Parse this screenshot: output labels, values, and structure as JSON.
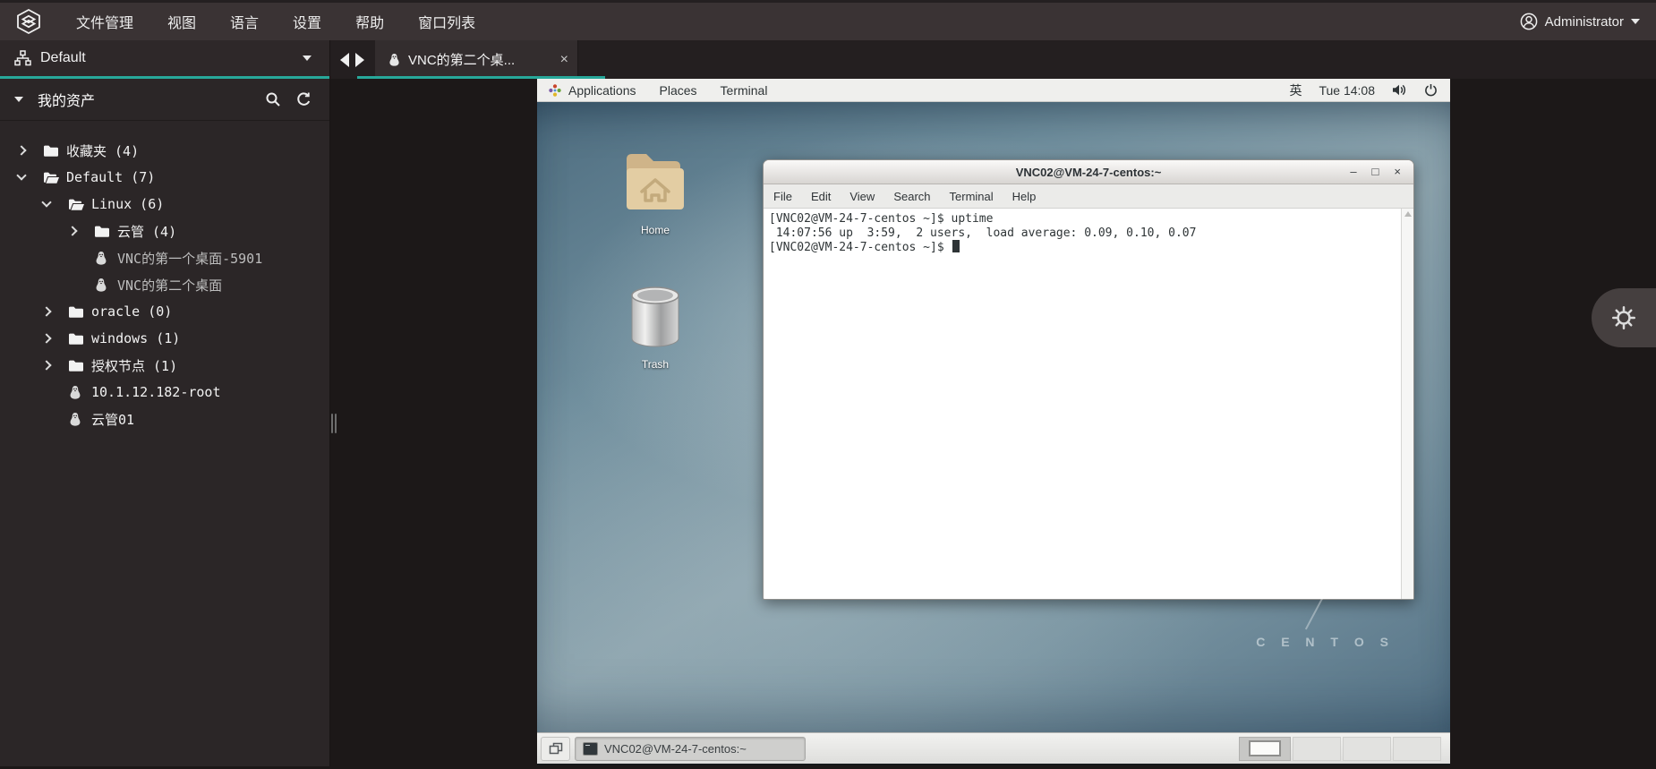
{
  "topbar": {
    "menu_items": [
      "文件管理",
      "视图",
      "语言",
      "设置",
      "帮助",
      "窗口列表"
    ],
    "user_name": "Administrator"
  },
  "sidebar": {
    "profile_label": "Default",
    "assets_title": "我的资产",
    "tree": [
      {
        "label": "收藏夹 (4)"
      },
      {
        "label": "Default (7)"
      },
      {
        "label": "Linux (6)"
      },
      {
        "label": "云管 (4)"
      },
      {
        "label": "VNC的第一个桌面-5901"
      },
      {
        "label": "VNC的第二个桌面"
      },
      {
        "label": "oracle (0)"
      },
      {
        "label": "windows (1)"
      },
      {
        "label": "授权节点 (1)"
      },
      {
        "label": "10.1.12.182-root"
      },
      {
        "label": "云管01"
      }
    ]
  },
  "tabbar": {
    "active_tab_label": "VNC的第二个桌...",
    "close_glyph": "×"
  },
  "remote": {
    "panel": {
      "menus": [
        "Applications",
        "Places",
        "Terminal"
      ],
      "input_indicator": "英",
      "clock": "Tue 14:08"
    },
    "desktop_icons": [
      {
        "label": "Home"
      },
      {
        "label": "Trash"
      }
    ],
    "terminal": {
      "title": "VNC02@VM-24-7-centos:~",
      "controls": [
        "–",
        "□",
        "×"
      ],
      "menus": [
        "File",
        "Edit",
        "View",
        "Search",
        "Terminal",
        "Help"
      ],
      "lines": [
        "[VNC02@VM-24-7-centos ~]$ uptime",
        " 14:07:56 up  3:59,  2 users,  load average: 0.09, 0.10, 0.07",
        "[VNC02@VM-24-7-centos ~]$ "
      ]
    },
    "taskbar": {
      "task_label": "VNC02@VM-24-7-centos:~",
      "workspace_count": 4
    },
    "watermark": "C E N T O S"
  },
  "colors": {
    "accent_teal": "#27a89a",
    "topbar_bg": "#3a3334",
    "sidebar_bg": "#2b2627",
    "stage_bg": "#1c1818",
    "panel_bg": "#efefed"
  }
}
